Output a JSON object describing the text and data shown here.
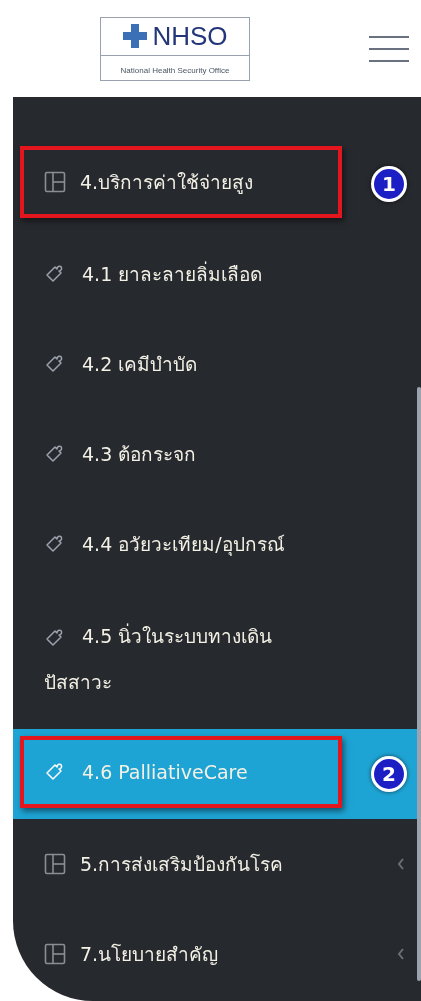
{
  "header": {
    "logo": {
      "title": "NHSO",
      "subtitle": "National Health Security Office"
    }
  },
  "menu": [
    {
      "kind": "section",
      "label": "4.บริการค่าใช้จ่ายสูง",
      "selected": false,
      "outlined": true,
      "callout": "1",
      "expandable": false
    },
    {
      "kind": "sub",
      "label": "4.1 ยาละลายลิ่มเลือด",
      "selected": false,
      "outlined": false,
      "expandable": false
    },
    {
      "kind": "sub",
      "label": "4.2 เคมีบำบัด",
      "selected": false,
      "outlined": false,
      "expandable": false
    },
    {
      "kind": "sub",
      "label": "4.3 ต้อกระจก",
      "selected": false,
      "outlined": false,
      "expandable": false
    },
    {
      "kind": "sub",
      "label": "4.4 อวัยวะเทียม/อุปกรณ์",
      "selected": false,
      "outlined": false,
      "expandable": false
    },
    {
      "kind": "sub",
      "label": "4.5 นิ่วในระบบทางเดินปัสสาวะ",
      "selected": false,
      "outlined": false,
      "expandable": false
    },
    {
      "kind": "sub",
      "label": "4.6 PalliativeCare",
      "selected": true,
      "outlined": true,
      "callout": "2",
      "expandable": false
    },
    {
      "kind": "section",
      "label": "5.การส่งเสริมป้องกันโรค",
      "selected": false,
      "outlined": false,
      "expandable": true
    },
    {
      "kind": "section",
      "label": "7.นโยบายสำคัญ",
      "selected": false,
      "outlined": false,
      "expandable": true
    }
  ]
}
